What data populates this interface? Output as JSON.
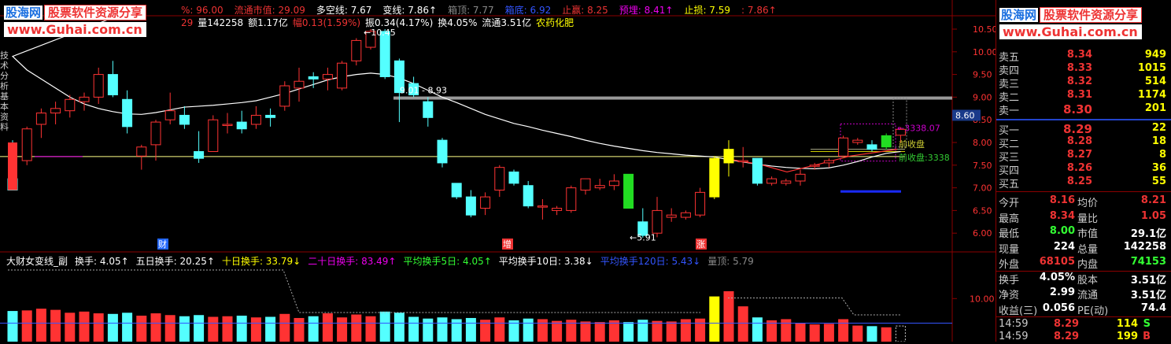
{
  "watermark": {
    "site_cn": "股海网",
    "tagline": "股票软件资源分享",
    "url": "www.Guhai.com.cn"
  },
  "header1": [
    {
      "t": "%: 96.00",
      "c": "#e33"
    },
    {
      "t": "流通市值: 29.09",
      "c": "#e33"
    },
    {
      "t": "多空线: 7.67",
      "c": "#fff"
    },
    {
      "t": "变线: 7.86↑",
      "c": "#fff"
    },
    {
      "t": "箱顶: 7.77",
      "c": "#888"
    },
    {
      "t": "箱底: 6.92",
      "c": "#3355ff"
    },
    {
      "t": "止赢: 8.25",
      "c": "#e33"
    },
    {
      "t": "预埋: 8.41↑",
      "c": "#e0e"
    },
    {
      "t": "止损: 7.59",
      "c": "#ff0"
    },
    {
      "t": ": 7.86↑",
      "c": "#e33"
    }
  ],
  "header2": [
    {
      "t": "29",
      "c": "#e33"
    },
    {
      "t": "量142258",
      "c": "#fff"
    },
    {
      "t": "额1.17亿",
      "c": "#fff"
    },
    {
      "t": "幅0.13(1.59%)",
      "c": "#e33"
    },
    {
      "t": "振0.34(4.17%)",
      "c": "#fff"
    },
    {
      "t": "换4.05%",
      "c": "#fff"
    },
    {
      "t": "流通3.51亿",
      "c": "#fff"
    },
    {
      "t": "农药化肥",
      "c": "#ff0"
    }
  ],
  "price_axis": [
    "10.50",
    "10.00",
    "9.50",
    "9.00",
    "8.50",
    "8.00",
    "7.50",
    "7.00",
    "6.50",
    "6.00"
  ],
  "price_marker": "8.60",
  "annotations": {
    "high": "10.45",
    "range": "9.01 - 8.93",
    "low": "5.91",
    "target": "3338.07",
    "prev_close": "前收盘",
    "prev_close2": "前收盘:3338"
  },
  "markers": [
    "财",
    "增",
    "涨"
  ],
  "left_tabs": [
    "技",
    "术",
    "分",
    "析",
    "基",
    "本",
    "资",
    "料"
  ],
  "lower_header": [
    {
      "t": "大财女变线_副",
      "c": "#fff"
    },
    {
      "t": "换手: 4.05↑",
      "c": "#fff"
    },
    {
      "t": "五日换手: 20.25↑",
      "c": "#fff"
    },
    {
      "t": "十日换手: 33.79↓",
      "c": "#ff0"
    },
    {
      "t": "二十日换手: 83.49↑",
      "c": "#e0e"
    },
    {
      "t": "平均换手5日: 4.05↑",
      "c": "#3f3"
    },
    {
      "t": "平均换手10日: 3.38↓",
      "c": "#fff"
    },
    {
      "t": "平均换手120日: 5.43↓",
      "c": "#3355ff"
    },
    {
      "t": "量顶: 5.79",
      "c": "#888"
    }
  ],
  "volume_axis": "10.00",
  "order_book": {
    "sells": [
      {
        "label": "卖五",
        "price": "8.34",
        "vol": "949"
      },
      {
        "label": "卖四",
        "price": "8.33",
        "vol": "1015"
      },
      {
        "label": "卖三",
        "price": "8.32",
        "vol": "514"
      },
      {
        "label": "卖二",
        "price": "8.31",
        "vol": "1174"
      },
      {
        "label": "卖一",
        "price": "8.30",
        "vol": "201"
      }
    ],
    "buys": [
      {
        "label": "买一",
        "price": "8.29",
        "vol": "22"
      },
      {
        "label": "买二",
        "price": "8.28",
        "vol": "18"
      },
      {
        "label": "买三",
        "price": "8.27",
        "vol": "8"
      },
      {
        "label": "买四",
        "price": "8.26",
        "vol": "36"
      },
      {
        "label": "买五",
        "price": "8.25",
        "vol": "55"
      }
    ]
  },
  "stats": [
    {
      "l1": "今开",
      "v1": "8.16",
      "c1": "#e33",
      "l2": "均价",
      "v2": "8.21",
      "c2": "#e33"
    },
    {
      "l1": "最高",
      "v1": "8.34",
      "c1": "#e33",
      "l2": "量比",
      "v2": "1.05",
      "c2": "#e33"
    },
    {
      "l1": "最低",
      "v1": "8.00",
      "c1": "#3f3",
      "l2": "市值",
      "v2": "29.1亿",
      "c2": "#fff"
    },
    {
      "l1": "现量",
      "v1": "224",
      "c1": "#fff",
      "l2": "总量",
      "v2": "142258",
      "c2": "#fff"
    },
    {
      "l1": "外盘",
      "v1": "68105",
      "c1": "#e33",
      "l2": "内盘",
      "v2": "74153",
      "c2": "#3f3"
    },
    {
      "l1": "换手",
      "v1": "4.05%",
      "c1": "#fff",
      "l2": "股本",
      "v2": "3.51亿",
      "c2": "#fff"
    },
    {
      "l1": "净资",
      "v1": "2.99",
      "c1": "#fff",
      "l2": "流通",
      "v2": "3.51亿",
      "c2": "#fff"
    },
    {
      "l1": "收益(三)",
      "v1": "0.056",
      "c1": "#fff",
      "l2": "PE(动)",
      "v2": "74.4",
      "c2": "#fff"
    }
  ],
  "ticks": [
    {
      "time": "14:59",
      "price": "8.29",
      "vol": "114",
      "side": "S",
      "side_color": "#3f3"
    },
    {
      "time": "14:59",
      "price": "8.29",
      "vol": "199",
      "side": "B",
      "side_color": "#e33"
    }
  ],
  "colors": {
    "up": "#ff3333",
    "down": "#54ffff",
    "grid": "#8b0000",
    "ma": "#ffffff"
  },
  "chart_data": {
    "type": "candlestick",
    "ohlc": [
      [
        7.2,
        8.05,
        6.95,
        6.95
      ],
      [
        7.6,
        8.35,
        7.5,
        8.3
      ],
      [
        8.4,
        8.75,
        8.1,
        8.65
      ],
      [
        8.65,
        8.9,
        8.4,
        8.75
      ],
      [
        8.7,
        9.05,
        8.55,
        8.95
      ],
      [
        8.9,
        9.1,
        8.7,
        9.0
      ],
      [
        9.0,
        9.65,
        8.85,
        9.5
      ],
      [
        9.5,
        9.8,
        9.0,
        9.05
      ],
      [
        8.95,
        9.15,
        8.2,
        8.35
      ],
      [
        7.7,
        7.95,
        7.4,
        7.9
      ],
      [
        7.95,
        8.5,
        7.6,
        8.45
      ],
      [
        8.5,
        9.1,
        8.4,
        8.7
      ],
      [
        8.6,
        8.8,
        8.3,
        8.4
      ],
      [
        7.8,
        8.25,
        7.55,
        7.65
      ],
      [
        7.8,
        8.6,
        7.8,
        8.5
      ],
      [
        8.4,
        8.65,
        8.2,
        8.4
      ],
      [
        8.45,
        8.7,
        8.2,
        8.3
      ],
      [
        8.4,
        8.8,
        8.3,
        8.6
      ],
      [
        8.6,
        8.75,
        8.35,
        8.55
      ],
      [
        8.8,
        9.35,
        8.7,
        9.25
      ],
      [
        9.2,
        9.65,
        8.9,
        9.35
      ],
      [
        9.45,
        9.55,
        9.2,
        9.4
      ],
      [
        9.4,
        9.65,
        9.15,
        9.5
      ],
      [
        9.2,
        9.8,
        9.15,
        9.75
      ],
      [
        9.8,
        10.3,
        9.7,
        10.25
      ],
      [
        10.1,
        10.5,
        10.05,
        10.45
      ],
      [
        10.45,
        10.5,
        9.4,
        9.45
      ],
      [
        9.8,
        9.85,
        8.45,
        9.1
      ],
      [
        9.3,
        9.45,
        9.0,
        9.05
      ],
      [
        8.9,
        9.0,
        8.35,
        8.55
      ],
      [
        8.05,
        8.1,
        7.45,
        7.55
      ],
      [
        7.1,
        7.1,
        6.75,
        6.8
      ],
      [
        6.8,
        6.95,
        6.35,
        6.4
      ],
      [
        6.55,
        6.9,
        6.4,
        6.8
      ],
      [
        6.95,
        7.5,
        6.8,
        7.45
      ],
      [
        7.35,
        7.4,
        7.05,
        7.1
      ],
      [
        7.05,
        7.15,
        6.55,
        6.6
      ],
      [
        6.6,
        6.75,
        6.3,
        6.6
      ],
      [
        6.5,
        6.6,
        6.4,
        6.55
      ],
      [
        6.5,
        7.05,
        6.45,
        7.0
      ],
      [
        6.95,
        7.2,
        6.85,
        7.2
      ],
      [
        7.0,
        7.2,
        6.95,
        7.05
      ],
      [
        7.05,
        7.3,
        6.95,
        7.15
      ],
      [
        7.3,
        7.3,
        6.6,
        6.55
      ],
      [
        6.25,
        6.55,
        5.9,
        5.95
      ],
      [
        6.0,
        6.8,
        5.91,
        6.5
      ],
      [
        6.35,
        6.55,
        6.25,
        6.4
      ],
      [
        6.35,
        6.5,
        6.3,
        6.45
      ],
      [
        6.4,
        7.0,
        6.35,
        6.9
      ],
      [
        6.8,
        7.7,
        6.75,
        7.65
      ],
      [
        7.55,
        8.05,
        7.25,
        7.85
      ],
      [
        7.6,
        7.9,
        7.45,
        7.6
      ],
      [
        7.65,
        7.65,
        7.05,
        7.1
      ],
      [
        7.1,
        7.25,
        7.05,
        7.2
      ],
      [
        7.1,
        7.2,
        7.05,
        7.15
      ],
      [
        7.15,
        7.4,
        7.05,
        7.3
      ],
      [
        7.5,
        7.55,
        7.4,
        7.5
      ],
      [
        7.55,
        7.65,
        7.45,
        7.6
      ],
      [
        7.7,
        8.15,
        7.7,
        8.1
      ],
      [
        8.0,
        8.1,
        7.95,
        8.05
      ],
      [
        7.95,
        8.05,
        7.8,
        7.85
      ],
      [
        7.9,
        8.2,
        7.85,
        8.15
      ],
      [
        8.16,
        8.34,
        8.0,
        8.29
      ]
    ],
    "ma": [
      9.9,
      9.6,
      9.4,
      9.2,
      9.0,
      8.85,
      8.75,
      8.68,
      8.63,
      8.62,
      8.66,
      8.72,
      8.78,
      8.8,
      8.82,
      8.85,
      8.88,
      8.92,
      9.0,
      9.08,
      9.18,
      9.28,
      9.38,
      9.45,
      9.5,
      9.53,
      9.5,
      9.42,
      9.3,
      9.15,
      9.0,
      8.88,
      8.75,
      8.62,
      8.52,
      8.42,
      8.35,
      8.27,
      8.2,
      8.13,
      8.05,
      7.98,
      7.92,
      7.87,
      7.82,
      7.78,
      7.75,
      7.72,
      7.7,
      7.68,
      7.62,
      7.57,
      7.52,
      7.48,
      7.45,
      7.43,
      7.42,
      7.44,
      7.5,
      7.58,
      7.68,
      7.76,
      7.8
    ],
    "volume": [
      7.8,
      7.9,
      8.2,
      8.0,
      7.5,
      7.7,
      7.4,
      7.3,
      7.5,
      7.0,
      7.4,
      7.1,
      6.9,
      7.1,
      6.8,
      6.9,
      7.0,
      6.7,
      6.8,
      7.3,
      6.6,
      6.9,
      7.4,
      6.7,
      7.2,
      6.9,
      7.7,
      7.5,
      6.8,
      6.5,
      6.7,
      6.4,
      6.6,
      6.3,
      6.7,
      6.2,
      6.5,
      6.4,
      6.1,
      6.3,
      6.0,
      5.9,
      6.2,
      5.9,
      6.3,
      6.1,
      6.0,
      6.4,
      6.5,
      10.3,
      11.2,
      8.6,
      6.7,
      6.2,
      6.4,
      5.7,
      5.5,
      5.6,
      6.4,
      5.3,
      5.2,
      5.0,
      5.3
    ],
    "volume_ma": [
      5.79
    ],
    "ylim": [
      5.9,
      10.7
    ]
  }
}
